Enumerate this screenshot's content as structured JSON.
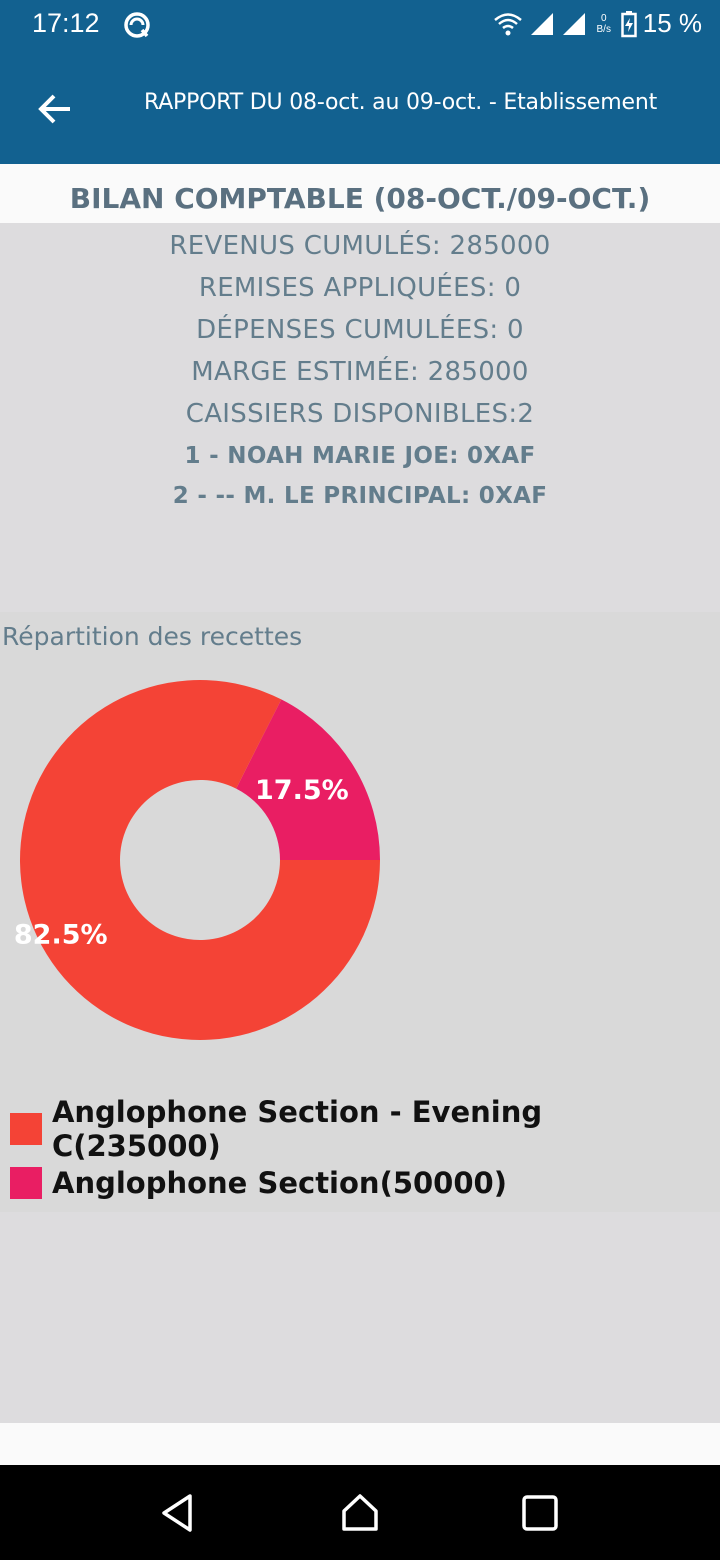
{
  "status_bar": {
    "time": "17:12",
    "net_speed_value": "0",
    "net_speed_unit": "B/s",
    "battery": "15 %",
    "icons": [
      "sync-icon",
      "wifi-icon",
      "signal-icon",
      "signal-icon",
      "battery-charging-icon"
    ]
  },
  "app_bar": {
    "title": "RAPPORT DU 08-oct. au 09-oct. - Etablissement",
    "back_icon": "arrow-back-icon",
    "color": "#126190"
  },
  "summary": {
    "heading": "BILAN COMPTABLE (08-OCT./09-OCT.)",
    "lines": [
      "REVENUS CUMULÉS: 285000",
      "REMISES APPLIQUÉES: 0",
      "DÉPENSES CUMULÉES: 0",
      "MARGE ESTIMÉE: 285000",
      "CAISSIERS DISPONIBLES:2"
    ],
    "cashiers": [
      "1 - NOAH MARIE JOE: 0XAF",
      "2 - -- M. LE PRINCIPAL: 0XAF"
    ]
  },
  "chart_panel": {
    "title": "Répartition des recettes"
  },
  "chart_data": {
    "type": "pie",
    "title": "Répartition des recettes",
    "series": [
      {
        "name": "Anglophone Section - Evening C(235000)",
        "value": 235000,
        "label": "82.5%",
        "color": "#f44336"
      },
      {
        "name": "Anglophone Section(50000)",
        "value": 50000,
        "label": "17.5%",
        "color": "#e91e63"
      }
    ],
    "legend_position": "bottom-left"
  },
  "nav_bar": {
    "buttons": [
      "back-triangle-icon",
      "home-icon",
      "recents-icon"
    ]
  }
}
